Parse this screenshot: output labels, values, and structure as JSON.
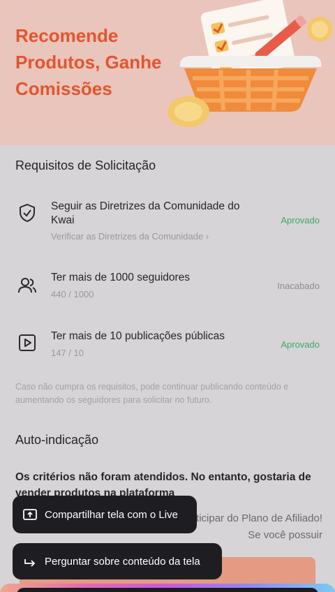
{
  "hero": {
    "title": "Recomende Produtos, Ganhe Comissões"
  },
  "requirements": {
    "section_title": "Requisitos de Solicitação",
    "items": [
      {
        "icon": "shield-check-icon",
        "title": "Seguir as Diretrizes da Comunidade do Kwai",
        "subtitle": "Verificar as Diretrizes da Comunidade ›",
        "status": "Aprovado"
      },
      {
        "icon": "users-icon",
        "title": "Ter mais de 1000 seguidores",
        "subtitle": "440 / 1000",
        "status": "Inacabado"
      },
      {
        "icon": "play-square-icon",
        "title": "Ter mais de 10 publicações públicas",
        "subtitle": "147 / 10",
        "status": "Aprovado"
      }
    ],
    "note": "Caso não cumpra os requisitos, pode continuar publicando conteúdo e aumentando os seguidores para solicitar no futuro."
  },
  "auto": {
    "section_title": "Auto-indicação",
    "body_bold": "Os critérios não foram atendidos. No entanto, gostaria de vender produtos na plataforma",
    "body_text": "s com habilidades de vendas para participar do Plano de Afiliado! Se você possuir"
  },
  "popups": {
    "share_label": "Compartilhar tela com o Live",
    "ask_label": "Perguntar sobre conteúdo da tela"
  },
  "colors": {
    "accent": "#e2552f",
    "approved": "#3aa96a",
    "pending": "#8f8f8f"
  }
}
